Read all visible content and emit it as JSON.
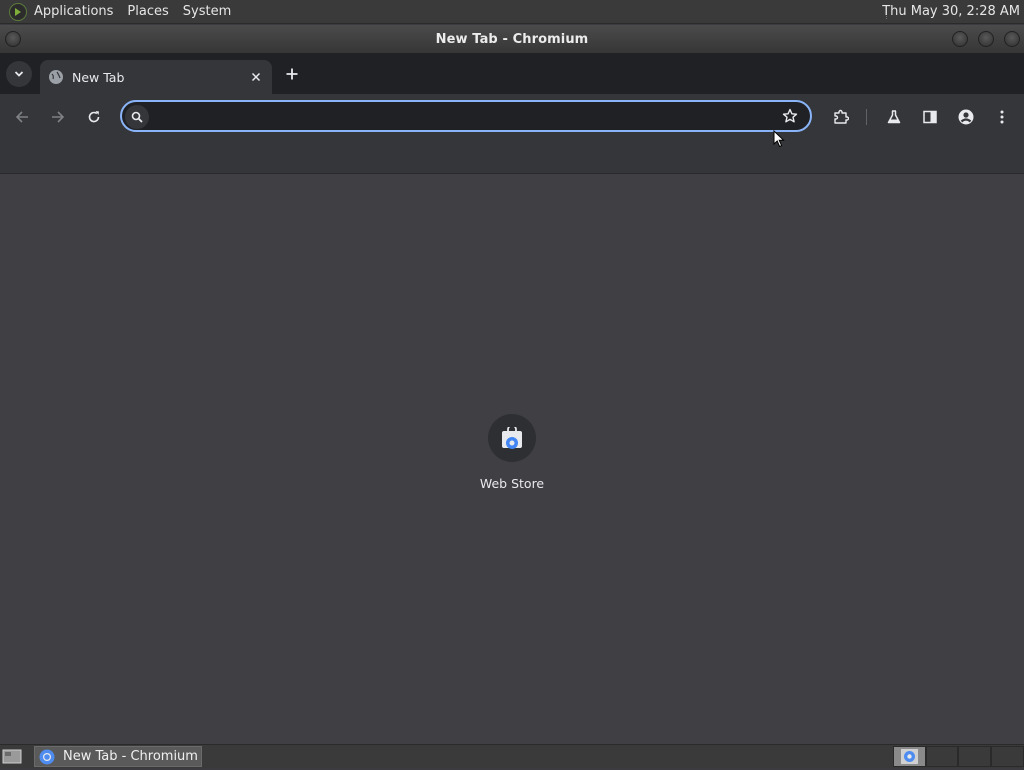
{
  "top_panel": {
    "menus": [
      "Applications",
      "Places",
      "System"
    ],
    "clock": "Thu May 30,  2:28 AM"
  },
  "window": {
    "title": "New Tab - Chromium"
  },
  "browser": {
    "tab": {
      "label": "New Tab"
    },
    "omnibox": {
      "value": "",
      "placeholder": ""
    }
  },
  "new_tab_page": {
    "shortcuts": [
      {
        "label": "Web Store",
        "icon": "web-store-icon"
      }
    ]
  },
  "bottom_panel": {
    "task_label": "New Tab - Chromium",
    "workspaces": 4,
    "active_workspace": 1
  },
  "colors": {
    "accent": "#8ab4f8",
    "toolbar": "#35363a",
    "tabstrip": "#202124",
    "content": "#3f3f44"
  }
}
